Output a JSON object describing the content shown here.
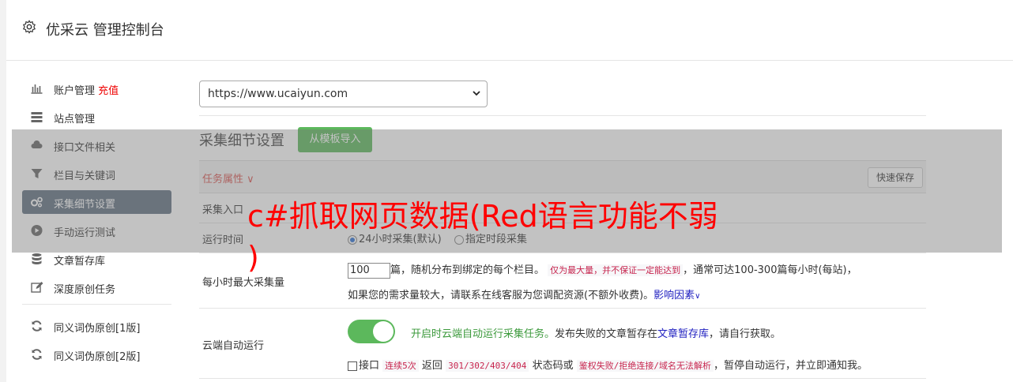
{
  "header": {
    "icon": "gear-icon",
    "title": "优采云 管理控制台"
  },
  "sidebar": {
    "items": [
      {
        "icon": "bar-chart-icon",
        "label": "账户管理",
        "badge": "充值"
      },
      {
        "icon": "server-icon",
        "label": "站点管理"
      },
      {
        "icon": "cloud-upload-icon",
        "label": "接口文件相关"
      },
      {
        "icon": "filter-icon",
        "label": "栏目与关键词"
      },
      {
        "icon": "gears-icon",
        "label": "采集细节设置",
        "active": true
      },
      {
        "icon": "play-circle-icon",
        "label": "手动运行测试"
      },
      {
        "icon": "database-icon",
        "label": "文章暂存库"
      },
      {
        "icon": "edit-icon",
        "label": "深度原创任务"
      },
      {
        "icon": "refresh-icon",
        "label": "同义词伪原创[1版]"
      },
      {
        "icon": "refresh-icon",
        "label": "同义词伪原创[2版]"
      }
    ]
  },
  "site_select": {
    "value": "https://www.ucaiyun.com"
  },
  "section": {
    "title": "采集细节设置",
    "import_button": "从模板导入"
  },
  "table": {
    "header_label": "任务属性",
    "quick_save": "快速保存",
    "rows": {
      "entry": {
        "label": "采集入口"
      },
      "runtime": {
        "label": "运行时间",
        "option1": "24小时采集(默认)",
        "option2": "指定时段采集"
      },
      "max": {
        "label": "每小时最大采集量",
        "value": "100",
        "text1": "篇，随机分布到绑定的每个栏目。",
        "code1": "仅为最大量，并不保证一定能达到",
        "text2": "，通常可达100-300篇每小时(每站)，",
        "text3": "如果您的需求量较大，请联系在线客服为您调配资源(不额外收费)。",
        "link": "影响因素"
      },
      "cloud": {
        "label": "云端自动运行",
        "green_text": "开启时云端自动运行采集任务。",
        "text1": "发布失败的文章暂存在",
        "link": "文章暂存库",
        "text2": "，请自行获取。",
        "chk_label": "接口",
        "code1": "连续5次",
        "text3": "返回",
        "code2": "301/302/403/404",
        "text4": "状态码或",
        "code3": "鉴权失败/拒绝连接/域名无法解析",
        "text5": "，暂停自动运行，并立即通知我。"
      }
    }
  },
  "overlay": {
    "line1": "c#抓取网页数据(Red语言功能不弱",
    "line2": ")"
  },
  "colors": {
    "accent_green": "#5cb85c",
    "active_item": "#5f6f80",
    "overlay_red": "#ff0000",
    "danger": "#d9534f"
  }
}
